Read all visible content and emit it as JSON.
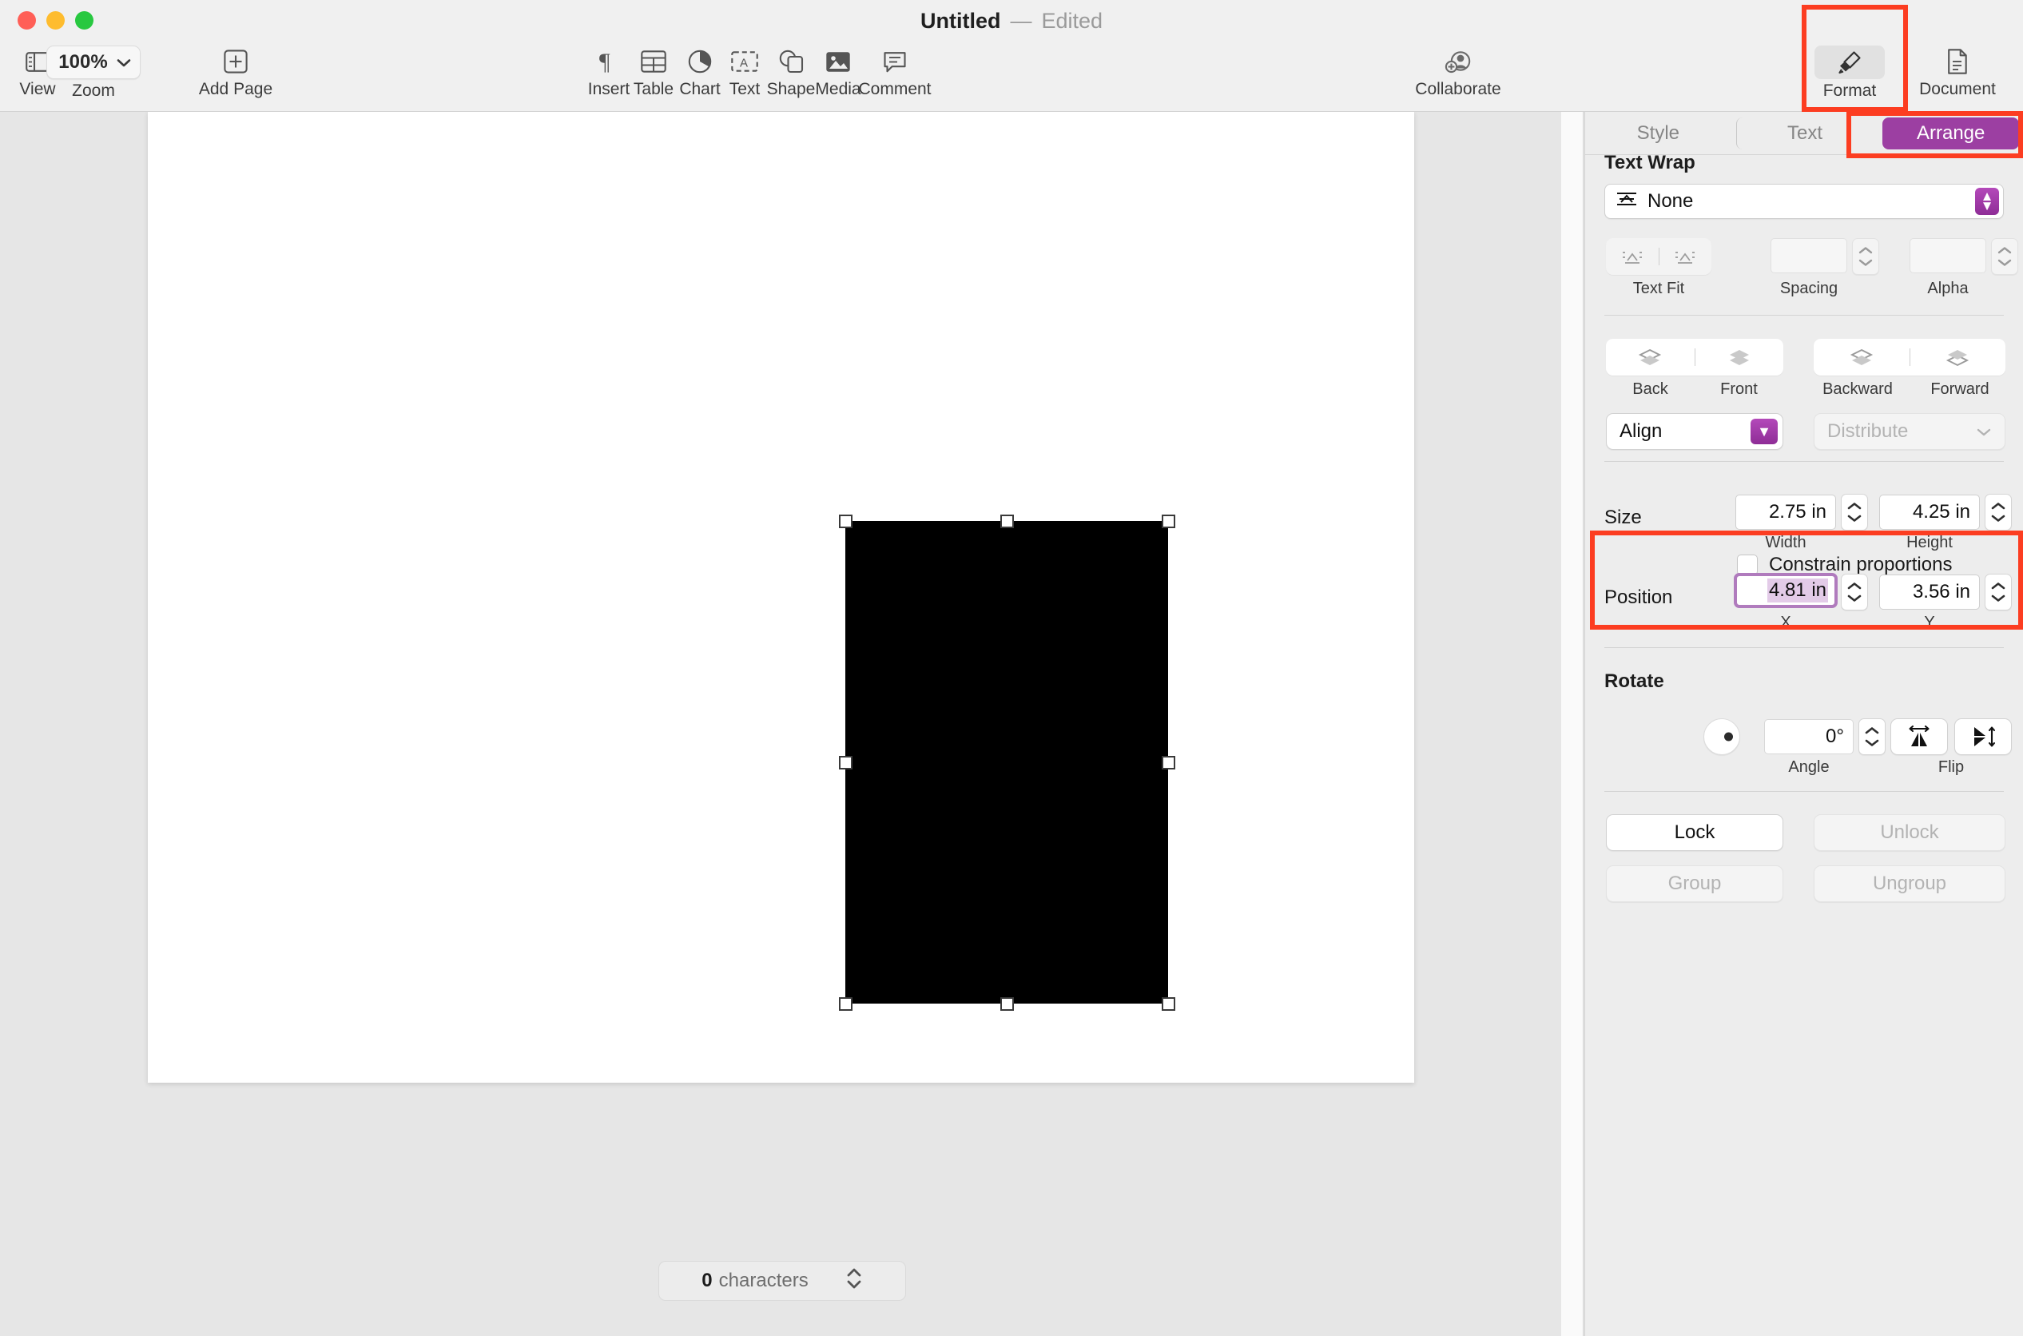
{
  "window": {
    "title": "Untitled",
    "dash": "—",
    "edit_state": "Edited"
  },
  "toolbar": {
    "view_label": "View",
    "zoom_label": "Zoom",
    "zoom_value": "100%",
    "add_page_label": "Add Page",
    "insert_label": "Insert",
    "table_label": "Table",
    "chart_label": "Chart",
    "text_label": "Text",
    "shape_label": "Shape",
    "media_label": "Media",
    "comment_label": "Comment",
    "collaborate_label": "Collaborate",
    "format_label": "Format",
    "document_label": "Document"
  },
  "status": {
    "count": "0",
    "count_label": "characters"
  },
  "sidebar": {
    "tabs": [
      {
        "label": "Style",
        "active": false
      },
      {
        "label": "Text",
        "active": false
      },
      {
        "label": "Arrange",
        "active": true
      }
    ],
    "text_wrap": {
      "heading": "Text Wrap",
      "value": "None",
      "text_fit_label": "Text Fit",
      "spacing_label": "Spacing",
      "spacing_value": "",
      "alpha_label": "Alpha",
      "alpha_value": ""
    },
    "order": {
      "back_label": "Back",
      "front_label": "Front",
      "backward_label": "Backward",
      "forward_label": "Forward",
      "align_label": "Align",
      "distribute_label": "Distribute"
    },
    "size": {
      "label": "Size",
      "width_value": "2.75 in",
      "width_label": "Width",
      "height_value": "4.25 in",
      "height_label": "Height",
      "constrain_label": "Constrain proportions",
      "constrain_checked": false
    },
    "position": {
      "label": "Position",
      "x_value": "4.81 in",
      "x_label": "X",
      "y_value": "3.56 in",
      "y_label": "Y"
    },
    "rotate": {
      "heading": "Rotate",
      "angle_value": "0°",
      "angle_label": "Angle",
      "flip_label": "Flip"
    },
    "lock": {
      "lock_label": "Lock",
      "unlock_label": "Unlock",
      "group_label": "Group",
      "ungroup_label": "Ungroup"
    }
  },
  "colors": {
    "accent_purple": "#9c3fa2",
    "annotation_red": "#fc3d21",
    "shape_fill": "#000000",
    "canvas_bg": "#e6e6e6",
    "chrome_bg": "#f0f0f0"
  }
}
